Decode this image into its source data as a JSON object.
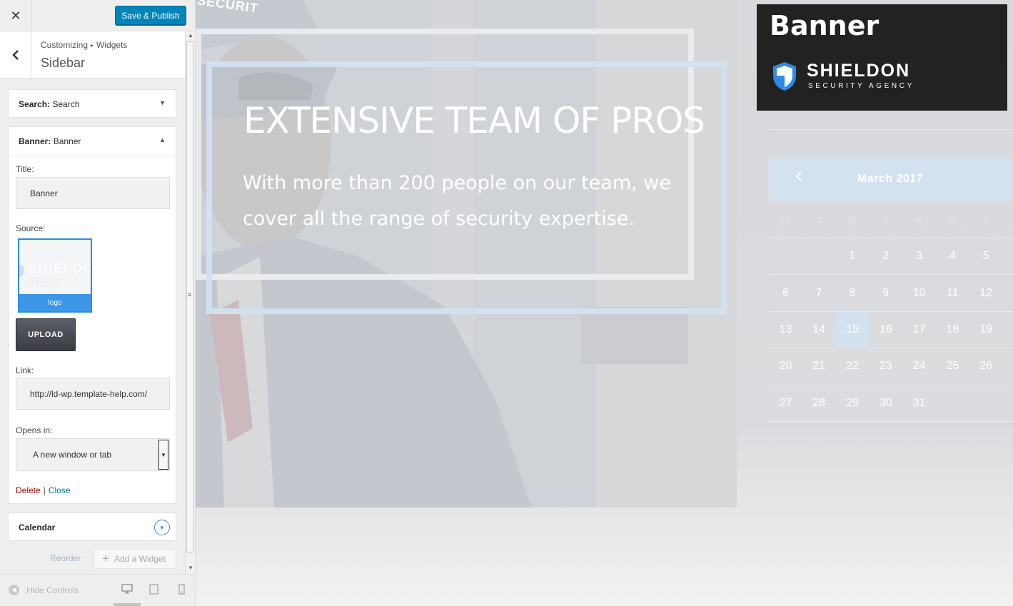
{
  "topbar": {
    "close_glyph": "✕",
    "publish_label": "Save & Publish"
  },
  "header": {
    "crumb_root": "Customizing",
    "crumb_child": "Widgets",
    "title": "Sidebar"
  },
  "widgets": {
    "search": {
      "type": "Search:",
      "name": "Search"
    },
    "banner": {
      "type": "Banner:",
      "name": "Banner",
      "title_label": "Title:",
      "title_value": "Banner",
      "source_label": "Source:",
      "thumb_caption": "logo",
      "upload_label": "UPLOAD",
      "link_label": "Link:",
      "link_value": "http://ld-wp.template-help.com/",
      "opens_label": "Opens in:",
      "opens_value": "A new window or tab",
      "delete_label": "Delete",
      "close_label": "Close"
    },
    "calendar": {
      "name": "Calendar"
    }
  },
  "actions": {
    "reorder_label": "Reorder",
    "add_widget_label": "Add a Widget"
  },
  "footer": {
    "hide_controls_label": "Hide Controls"
  },
  "preview": {
    "cap_text": "SECURIT",
    "hero_title": "EXTENSIVE TEAM OF PROS",
    "hero_subtitle": "With more than 200 people on our team, we cover all the range of security expertise.",
    "banner_widget": {
      "title": "Banner",
      "brand_name": "SHIELDON",
      "brand_tagline": "SECURITY AGENCY",
      "thumb_brand": "SHIELDON",
      "thumb_tagline": "SECURITY AGENCY"
    },
    "calendar": {
      "month": "March 2017",
      "weekdays": [
        "M",
        "T",
        "W",
        "T",
        "F",
        "S",
        "S"
      ],
      "weeks": [
        [
          "",
          "",
          "1",
          "2",
          "3",
          "4",
          "5"
        ],
        [
          "6",
          "7",
          "8",
          "9",
          "10",
          "11",
          "12"
        ],
        [
          "13",
          "14",
          "15",
          "16",
          "17",
          "18",
          "19"
        ],
        [
          "20",
          "21",
          "22",
          "23",
          "24",
          "25",
          "26"
        ],
        [
          "27",
          "28",
          "29",
          "30",
          "31",
          "",
          ""
        ]
      ],
      "today": "15"
    }
  },
  "colors": {
    "publish": "#0085ba",
    "accent_blue": "#2e8ae6",
    "banner_bg": "#222222",
    "calendar_header": "#d4e2f0"
  }
}
